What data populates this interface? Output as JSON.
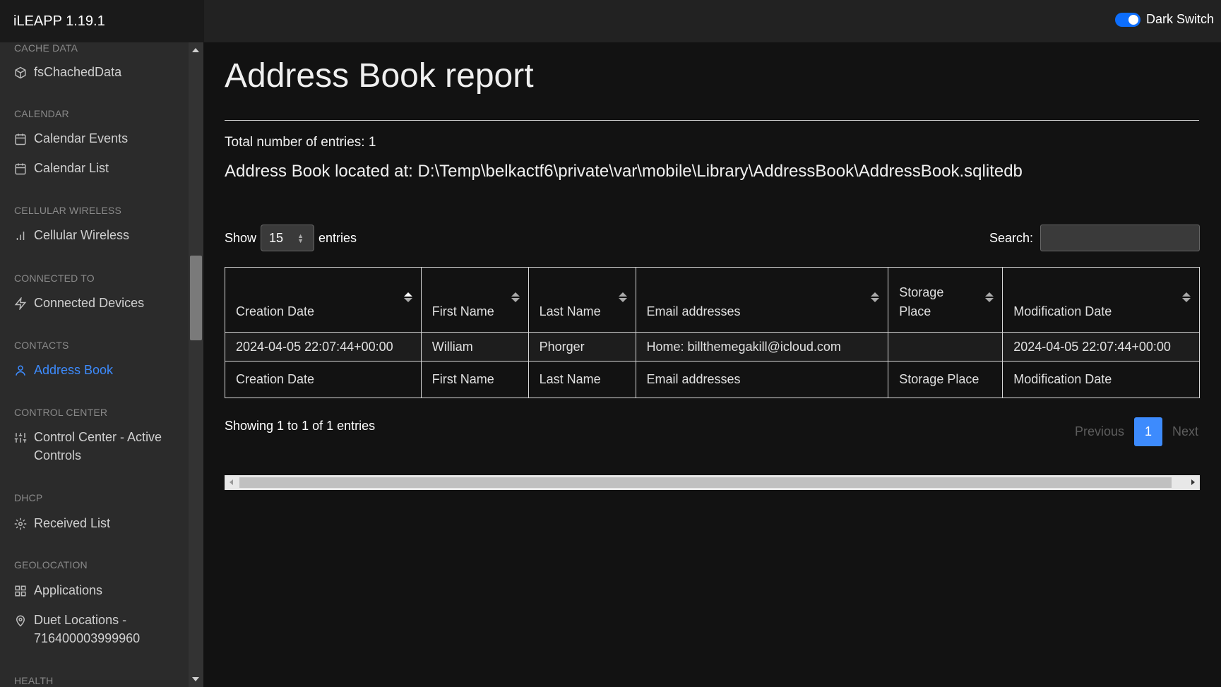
{
  "app": {
    "title": "iLEAPP 1.19.1",
    "dark_switch_label": "Dark Switch"
  },
  "sidebar": {
    "sections": [
      {
        "header": "CACHE DATA",
        "items": [
          {
            "label": "fsChachedData",
            "icon": "cube-icon"
          }
        ]
      },
      {
        "header": "CALENDAR",
        "items": [
          {
            "label": "Calendar Events",
            "icon": "calendar-icon"
          },
          {
            "label": "Calendar List",
            "icon": "calendar-icon"
          }
        ]
      },
      {
        "header": "CELLULAR WIRELESS",
        "items": [
          {
            "label": "Cellular Wireless",
            "icon": "bar-chart-icon"
          }
        ]
      },
      {
        "header": "CONNECTED TO",
        "items": [
          {
            "label": "Connected Devices",
            "icon": "zap-icon"
          }
        ]
      },
      {
        "header": "CONTACTS",
        "items": [
          {
            "label": "Address Book",
            "icon": "user-icon",
            "active": true
          }
        ]
      },
      {
        "header": "CONTROL CENTER",
        "items": [
          {
            "label": "Control Center - Active Controls",
            "icon": "sliders-icon"
          }
        ]
      },
      {
        "header": "DHCP",
        "items": [
          {
            "label": "Received List",
            "icon": "settings-icon"
          }
        ]
      },
      {
        "header": "GEOLOCATION",
        "items": [
          {
            "label": "Applications",
            "icon": "grid-icon"
          },
          {
            "label": "Duet Locations - 716400003999960",
            "icon": "map-pin-icon"
          }
        ]
      },
      {
        "header": "HEALTH",
        "items": []
      }
    ],
    "active_color": "#3d8bfd"
  },
  "report": {
    "title": "Address Book report",
    "total_entries": "Total number of entries: 1",
    "location": "Address Book located at: D:\\Temp\\belkactf6\\private\\var\\mobile\\Library\\AddressBook\\AddressBook.sqlitedb"
  },
  "table_controls": {
    "show_label": "Show",
    "page_size": "15",
    "entries_label": "entries",
    "search_label": "Search:",
    "search_value": ""
  },
  "table": {
    "columns": [
      "Creation Date",
      "First Name",
      "Last Name",
      "Email addresses",
      "Storage Place",
      "Modification Date"
    ],
    "rows": [
      [
        "2024-04-05 22:07:44+00:00",
        "William",
        "Phorger",
        "Home: billthemegakill@icloud.com",
        "",
        "2024-04-05 22:07:44+00:00"
      ]
    ],
    "footer": [
      "Creation Date",
      "First Name",
      "Last Name",
      "Email addresses",
      "Storage Place",
      "Modification Date"
    ]
  },
  "pagination": {
    "info": "Showing 1 to 1 of 1 entries",
    "previous": "Previous",
    "current_page": "1",
    "next": "Next"
  }
}
